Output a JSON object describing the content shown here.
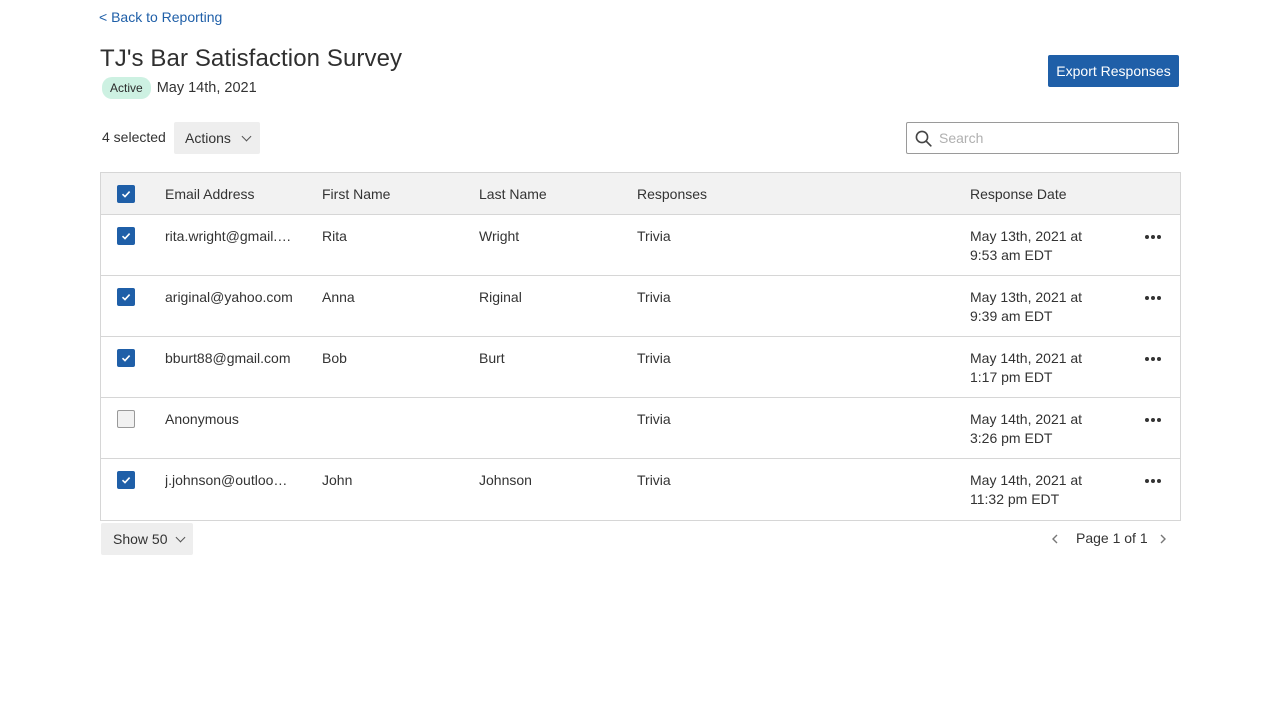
{
  "nav": {
    "back_label": "< Back to Reporting"
  },
  "survey": {
    "title": "TJ's Bar Satisfaction Survey",
    "status": "Active",
    "date": "May 14th, 2021"
  },
  "header_actions": {
    "export_label": "Export Responses"
  },
  "toolbar": {
    "selected_count": "4 selected",
    "actions_label": "Actions",
    "search_placeholder": "Search",
    "search_value": ""
  },
  "table": {
    "columns": {
      "email": "Email Address",
      "first": "First Name",
      "last": "Last Name",
      "responses": "Responses",
      "date": "Response Date"
    },
    "header_checked": true,
    "rows": [
      {
        "checked": true,
        "email": "rita.wright@gmail.c...",
        "first": "Rita",
        "last": "Wright",
        "responses": "Trivia",
        "date_line1": "May 13th, 2021 at",
        "date_line2": "9:53 am EDT"
      },
      {
        "checked": true,
        "email": "ariginal@yahoo.com",
        "first": "Anna",
        "last": "Riginal",
        "responses": "Trivia",
        "date_line1": "May 13th, 2021 at",
        "date_line2": "9:39 am EDT"
      },
      {
        "checked": true,
        "email": "bburt88@gmail.com",
        "first": "Bob",
        "last": "Burt",
        "responses": "Trivia",
        "date_line1": "May 14th, 2021 at",
        "date_line2": "1:17 pm EDT"
      },
      {
        "checked": false,
        "email": "Anonymous",
        "first": "",
        "last": "",
        "responses": "Trivia",
        "date_line1": "May 14th, 2021 at",
        "date_line2": "3:26 pm EDT"
      },
      {
        "checked": true,
        "email": "j.johnson@outlook....",
        "first": "John",
        "last": "Johnson",
        "responses": "Trivia",
        "date_line1": "May 14th, 2021 at",
        "date_line2": "11:32 pm EDT"
      }
    ]
  },
  "footer": {
    "show_label": "Show 50",
    "page_label": "Page 1 of 1"
  },
  "icons": {
    "checkbox": "check-icon",
    "row_menu": "more-horizontal-icon",
    "search": "search-icon",
    "prev": "chevron-left-icon",
    "next": "chevron-right-icon",
    "dropdown": "chevron-down-icon"
  },
  "colors": {
    "accent": "#1f5fa8",
    "status_active_bg": "#cdf1e2"
  }
}
